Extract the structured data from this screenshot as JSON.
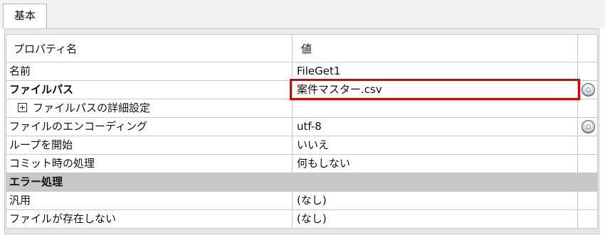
{
  "tab": {
    "label": "基本"
  },
  "grid": {
    "header": {
      "name": "プロパティ名",
      "value": "値"
    },
    "rows": [
      {
        "name": "名前",
        "value": "FileGet1"
      },
      {
        "name": "ファイルパス",
        "value": "案件マスター.csv"
      },
      {
        "name": "ファイルパスの詳細設定",
        "value": ""
      },
      {
        "name": "ファイルのエンコーディング",
        "value": "utf-8"
      },
      {
        "name": "ループを開始",
        "value": "いいえ"
      },
      {
        "name": "コミット時の処理",
        "value": "何もしない"
      },
      {
        "name": "エラー処理",
        "value": ""
      },
      {
        "name": "汎用",
        "value": "(なし)"
      },
      {
        "name": "ファイルが存在しない",
        "value": "(なし)"
      }
    ]
  },
  "colors": {
    "highlight": "#e00000",
    "section_bg": "#c8c8c8"
  },
  "icons": {
    "file_path_button": "gear-icon",
    "encoding_button": "gear-icon",
    "expand": "plus-box-icon"
  }
}
